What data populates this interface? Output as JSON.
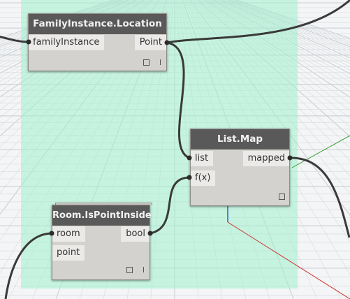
{
  "colors": {
    "group": "#a0f0cd",
    "node_header": "#595959",
    "node_body": "#d4d2cf",
    "port_bg": "#ebeae8",
    "wire": "#3a3a3a",
    "axis_x": "#d03030",
    "axis_y": "#2f9a2f",
    "axis_z": "#2d5fcc"
  },
  "nodes": {
    "family_location": {
      "title": "FamilyInstance.Location",
      "inputs": [
        "familyInstance"
      ],
      "outputs": [
        "Point"
      ]
    },
    "list_map": {
      "title": "List.Map",
      "inputs": [
        "list",
        "f(x)"
      ],
      "outputs": [
        "mapped"
      ]
    },
    "room_point_inside": {
      "title": "Room.IsPointInside",
      "inputs": [
        "room",
        "point"
      ],
      "outputs": [
        "bool"
      ]
    }
  }
}
